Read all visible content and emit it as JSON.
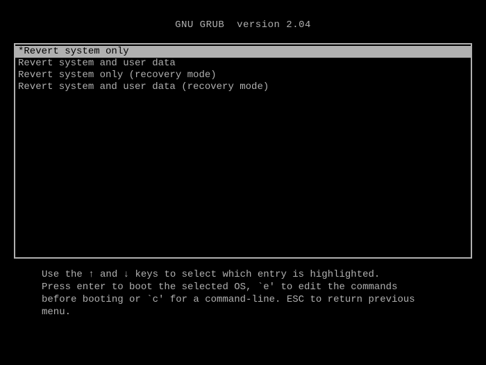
{
  "title_left": "GNU GRUB",
  "title_right": "version 2.04",
  "menu": {
    "items": [
      {
        "label": "Revert system only",
        "selected": true
      },
      {
        "label": "Revert system and user data",
        "selected": false
      },
      {
        "label": "Revert system only (recovery mode)",
        "selected": false
      },
      {
        "label": "Revert system and user data (recovery mode)",
        "selected": false
      }
    ]
  },
  "help": {
    "line1_a": "Use the ",
    "line1_b": " and ",
    "line1_c": " keys to select which entry is highlighted.",
    "line2": "Press enter to boot the selected OS, `e' to edit the commands",
    "line3": "before booting or `c' for a command-line. ESC to return previous",
    "line4": "menu."
  },
  "arrows": {
    "up": "↑",
    "down": "↓"
  }
}
